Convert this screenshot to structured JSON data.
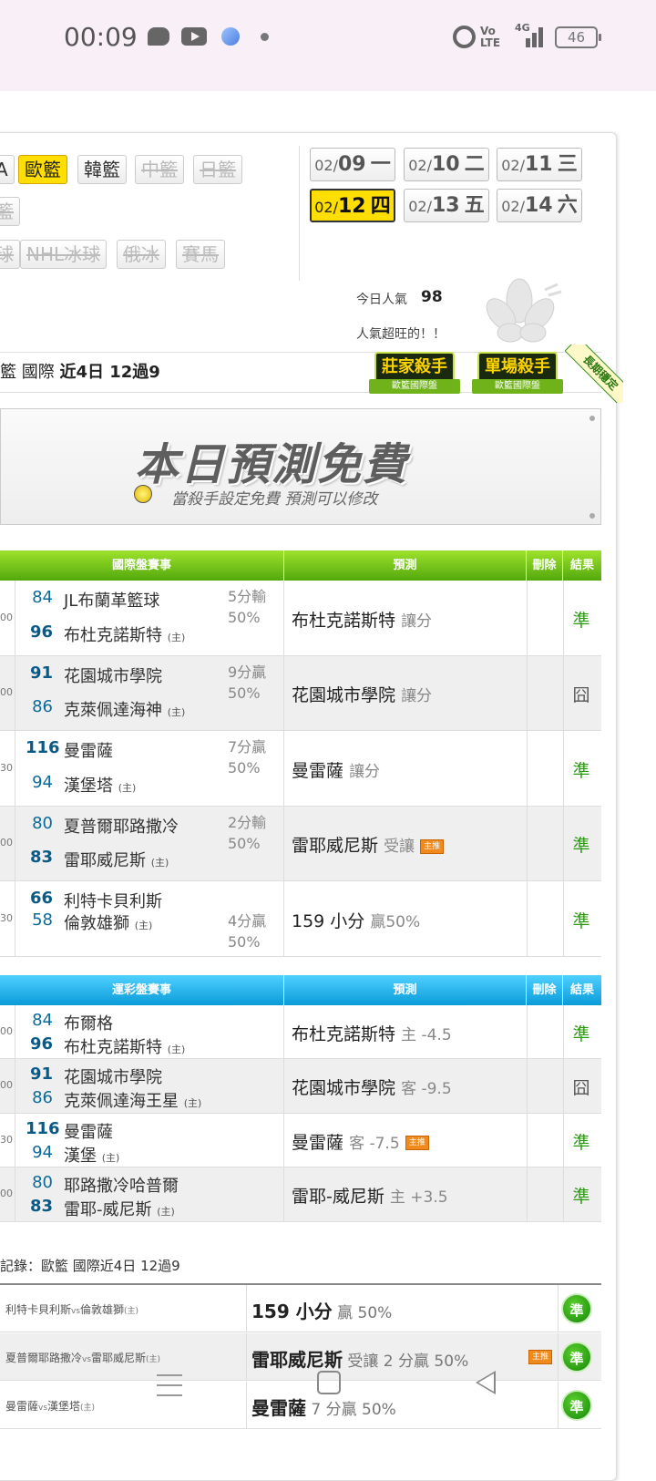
{
  "status_bar": {
    "time": "00:09",
    "volte": "Vo\nLTE",
    "network": "4G",
    "battery": "46"
  },
  "leagues": {
    "row1": [
      {
        "label": "A",
        "state": "normal"
      },
      {
        "label": "歐籃",
        "state": "active"
      },
      {
        "label": "韓籃",
        "state": "normal"
      },
      {
        "label": "中籃",
        "state": "disabled"
      },
      {
        "label": "日籃",
        "state": "disabled"
      }
    ],
    "row2": [
      {
        "label": "籃",
        "state": "disabled"
      }
    ],
    "row3": [
      {
        "label": "球",
        "state": "disabled"
      },
      {
        "label": "NHL冰球",
        "state": "disabled"
      },
      {
        "label": "俄冰",
        "state": "disabled"
      },
      {
        "label": "賽馬",
        "state": "disabled"
      }
    ]
  },
  "dates": [
    {
      "md": "02/",
      "day": "09",
      "wd": "一",
      "active": false
    },
    {
      "md": "02/",
      "day": "10",
      "wd": "二",
      "active": false
    },
    {
      "md": "02/",
      "day": "11",
      "wd": "三",
      "active": false
    },
    {
      "md": "02/",
      "day": "12",
      "wd": "四",
      "active": true
    },
    {
      "md": "02/",
      "day": "13",
      "wd": "五",
      "active": false
    },
    {
      "md": "02/",
      "day": "14",
      "wd": "六",
      "active": false
    }
  ],
  "popularity": {
    "label": "今日人氣",
    "value": "98",
    "note": "人氣超旺的！！"
  },
  "record_bar": {
    "prefix": "籃 國際 ",
    "bold": "近4日 12過9"
  },
  "badges": [
    {
      "title": "莊家殺手",
      "sub": "歐籃國際盤"
    },
    {
      "title": "單場殺手",
      "sub": "歐籃國際盤"
    }
  ],
  "ribbon": "長期穩定",
  "banner": {
    "title": "本日預測免費",
    "subtitle": "當殺手設定免費  預測可以修改"
  },
  "table1": {
    "headers": {
      "game": "國際盤賽事",
      "pred": "預測",
      "del": "刪除",
      "result": "結果"
    },
    "rows": [
      {
        "odd": "00",
        "s1": "84",
        "t1": "JL布蘭革籃球",
        "s2": "96",
        "t2": "布杜克諾斯特",
        "host": "(主)",
        "spread": "5分輸\n50%",
        "pred": "布杜克諾斯特",
        "pred_g": "讓分",
        "tag": "",
        "result": "準",
        "ok": true
      },
      {
        "odd": "00",
        "s1": "91",
        "t1": "花園城市學院",
        "s2": "86",
        "t2": "克萊佩達海神",
        "host": "(主)",
        "spread": "9分贏\n50%",
        "pred": "花園城市學院",
        "pred_g": "讓分",
        "tag": "",
        "result": "囧",
        "ok": false
      },
      {
        "odd": "30",
        "s1": "116",
        "t1": "曼雷薩",
        "s2": "94",
        "t2": "漢堡塔",
        "host": "(主)",
        "spread": "7分贏\n50%",
        "pred": "曼雷薩",
        "pred_g": "讓分",
        "tag": "",
        "result": "準",
        "ok": true
      },
      {
        "odd": "00",
        "s1": "80",
        "t1": "夏普爾耶路撒冷",
        "s2": "83",
        "t2": "雷耶威尼斯",
        "host": "(主)",
        "spread": "2分輸\n50%",
        "pred": "雷耶威尼斯",
        "pred_g": "受讓",
        "tag": "主推",
        "result": "準",
        "ok": true
      },
      {
        "odd": "30",
        "s1": "66",
        "t1": "利特卡貝利斯",
        "s2": "58",
        "t2": "倫敦雄獅",
        "host": "(主)",
        "spread": "4分贏\n50%",
        "pred": "159 小分",
        "pred_g": "贏50%",
        "tag": "",
        "result": "準",
        "ok": true
      }
    ]
  },
  "table2": {
    "headers": {
      "game": "運彩盤賽事",
      "pred": "預測",
      "del": "刪除",
      "result": "結果"
    },
    "rows": [
      {
        "odd": "00",
        "s1": "84",
        "t1": "布爾格",
        "s2": "96",
        "t2": "布杜克諾斯特",
        "host": "(主)",
        "pred": "布杜克諾斯特",
        "pred_g": "主 -4.5",
        "tag": "",
        "result": "準",
        "ok": true
      },
      {
        "odd": "00",
        "s1": "91",
        "t1": "花園城市學院",
        "s2": "86",
        "t2": "克萊佩達海王星",
        "host": "(主)",
        "pred": "花園城市學院",
        "pred_g": "客 -9.5",
        "tag": "",
        "result": "囧",
        "ok": false
      },
      {
        "odd": "30",
        "s1": "116",
        "t1": "曼雷薩",
        "s2": "94",
        "t2": "漢堡",
        "host": "(主)",
        "pred": "曼雷薩",
        "pred_g": "客 -7.5",
        "tag": "主推",
        "result": "準",
        "ok": true
      },
      {
        "odd": "00",
        "s1": "80",
        "t1": "耶路撒冷哈普爾",
        "s2": "83",
        "t2": "雷耶-威尼斯",
        "host": "(主)",
        "pred": "雷耶-威尼斯",
        "pred_g": "主 +3.5",
        "tag": "",
        "result": "準",
        "ok": true
      }
    ]
  },
  "record": {
    "title": "記錄：歐籃 國際近4日 12過9",
    "rows": [
      {
        "home": "利特卡貝利斯",
        "vs": "vs",
        "away": "倫敦雄獅",
        "host": "(主)",
        "pred": "159 小分",
        "pred_g": " 贏 50%",
        "tag": "",
        "result": "準"
      },
      {
        "home": "夏普爾耶路撒冷",
        "vs": "vs",
        "away": "雷耶威尼斯",
        "host": "(主)",
        "pred": "雷耶威尼斯",
        "pred_g": " 受讓 2 分贏 50%",
        "tag": "主推",
        "result": "準"
      },
      {
        "home": "曼雷薩",
        "vs": "vs",
        "away": "漢堡塔",
        "host": "(主)",
        "pred": "曼雷薩",
        "pred_g": " 7 分贏 50%",
        "tag": "",
        "result": "準"
      }
    ]
  }
}
